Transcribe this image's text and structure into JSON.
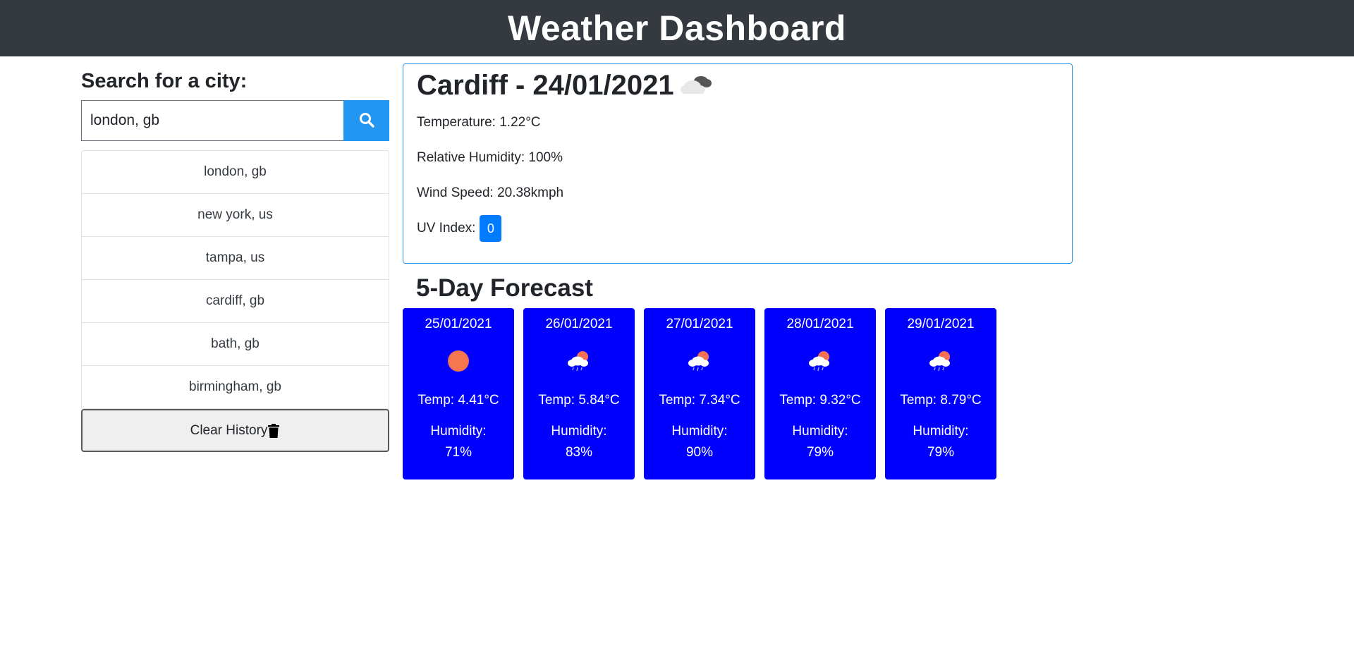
{
  "header": {
    "title": "Weather Dashboard"
  },
  "search": {
    "heading": "Search for a city:",
    "value": "london, gb",
    "icon": "search-icon"
  },
  "history": {
    "items": [
      "london, gb",
      "new york, us",
      "tampa, us",
      "cardiff, gb",
      "bath, gb",
      "birmingham, gb"
    ],
    "clear_label": "Clear History",
    "clear_icon": "trash-icon"
  },
  "current": {
    "title": "Cardiff - 24/01/2021",
    "icon": "broken-clouds-icon",
    "temperature": "Temperature: 1.22°C",
    "humidity": "Relative Humidity: 100%",
    "wind": "Wind Speed: 20.38kmph",
    "uv_label": "UV Index:",
    "uv_value": "0"
  },
  "forecast": {
    "heading": "5-Day Forecast",
    "days": [
      {
        "date": "25/01/2021",
        "icon": "sun-icon",
        "temp": "Temp: 4.41°C",
        "humidity_label": "Humidity:",
        "humidity": "71%"
      },
      {
        "date": "26/01/2021",
        "icon": "sun-rain-cloud-icon",
        "temp": "Temp: 5.84°C",
        "humidity_label": "Humidity:",
        "humidity": "83%"
      },
      {
        "date": "27/01/2021",
        "icon": "sun-rain-cloud-icon",
        "temp": "Temp: 7.34°C",
        "humidity_label": "Humidity:",
        "humidity": "90%"
      },
      {
        "date": "28/01/2021",
        "icon": "sun-rain-cloud-icon",
        "temp": "Temp: 9.32°C",
        "humidity_label": "Humidity:",
        "humidity": "79%"
      },
      {
        "date": "29/01/2021",
        "icon": "sun-rain-cloud-icon",
        "temp": "Temp: 8.79°C",
        "humidity_label": "Humidity:",
        "humidity": "79%"
      }
    ]
  },
  "colors": {
    "header_bg": "#343a40",
    "accent": "#2196f3",
    "uv_badge": "#007bff",
    "forecast_card": "#0000ff"
  }
}
